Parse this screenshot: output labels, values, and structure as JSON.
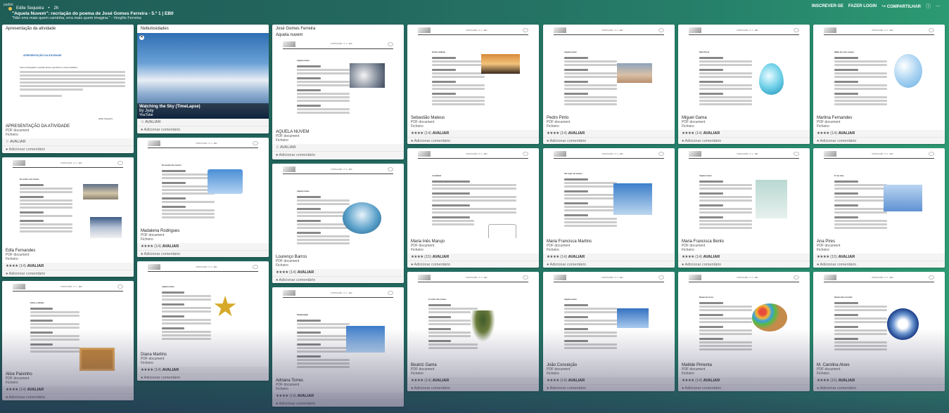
{
  "header": {
    "pad_label": "padlet",
    "author": "Edite Sequeira",
    "age": "2h",
    "title": "\"Aquela Nuvem\": recriação do poema de José Gomes Ferreira - 5.º 1 | EB0",
    "subtitle": "\"Não erra mais quem caminha, erra mais quem imagina.\" - Vergílio Ferreira",
    "actions": {
      "signup": "INSCREVER-SE",
      "login": "FAZER LOGIN",
      "share": "COMPARTILHAR"
    }
  },
  "common": {
    "doc_type": "PDF document",
    "doc_source": "Ficheiro",
    "rate": "AVALIAR",
    "add_comment": "Adicionar comentário",
    "stars": "★★★★",
    "doc_head": "PORTUGUÊS - 5.º 1 - EB0"
  },
  "cards": {
    "c1": {
      "title": "Apresentação da atividade",
      "thumb_title": "APRESENTAÇÃO DA ATIVIDADE",
      "body1": "Caros encarregados e queridos alunos, aqui ficam os vossos trabalhos...",
      "sign": "Edite Sequeira",
      "name": "APRESENTAÇÃO DA ATIVIDADE"
    },
    "c2": {
      "name": "Edla Fernandes",
      "rating": "(14)"
    },
    "c3": {
      "name": "Alice Paixinho",
      "rating": "(14)"
    },
    "c4": {
      "title": "Nebulosidades",
      "video_title": "Watching the Sky (TimeLapse)",
      "video_by": "by Jyay",
      "video_src": "YouTube"
    },
    "c5": {
      "name": "Madalena Rodrigues",
      "rating": "(14)"
    },
    "c6": {
      "name": "Diana Martins",
      "rating": "(14)"
    },
    "c7": {
      "title": "José Gomes Ferreira",
      "subtitle": "Aquela nuvem",
      "name": "AQUELA NUVEM"
    },
    "c8": {
      "name": "Lourenço Barros",
      "rating": "(14)"
    },
    "c9": {
      "name": "Adriana Torres",
      "rating": "(14)"
    },
    "c10": {
      "name": "Sebastião Mateus",
      "rating": "(14)"
    },
    "c11": {
      "name": "Maria Inês Marujo",
      "rating": "(15)"
    },
    "c12": {
      "name": "Beatriz Gama",
      "rating": "(14)"
    },
    "c13": {
      "name": "Pedro Pinto",
      "rating": "(14)"
    },
    "c14": {
      "name": "Maria Francisca Martins",
      "rating": "(14)"
    },
    "c15": {
      "name": "João Conceição",
      "rating": "(14)"
    },
    "c16": {
      "name": "Miguel Gama",
      "rating": "(14)"
    },
    "c17": {
      "name": "Maria Francisca Bento",
      "rating": "(14)"
    },
    "c18": {
      "name": "Matilde Pimenta",
      "rating": "(14)"
    },
    "c19": {
      "name": "Martina Fernandes",
      "rating": "(14)"
    },
    "c20": {
      "name": "Ana Pires",
      "rating": "(15)"
    },
    "c21": {
      "name": "M. Carolina Alves",
      "rating": "(15)"
    }
  },
  "poem_titles": {
    "t2": "Eu sonho com nuvens",
    "t3": "Sobre o telhado",
    "t5": "No mundo das nuvens",
    "t6": "Aquela nuvem",
    "t7": "Aquela nuvem",
    "t8": "Aquela nuvem",
    "t9": "Simplicidade",
    "t10": "Sonho radiante",
    "t11": "A maldade",
    "t12": "O sonho das nuvens",
    "t13": "Aquela nuvem",
    "t14": "Um sopro de nuvens",
    "t15": "Aquela nuvem",
    "t16": "Num Piscar",
    "t17": "Aquela nuvem",
    "t18": "Nuvem de cores",
    "t19": "Balão de cores suaves",
    "t20": "E sou uma",
    "t21": "Nuvem das recordas"
  }
}
